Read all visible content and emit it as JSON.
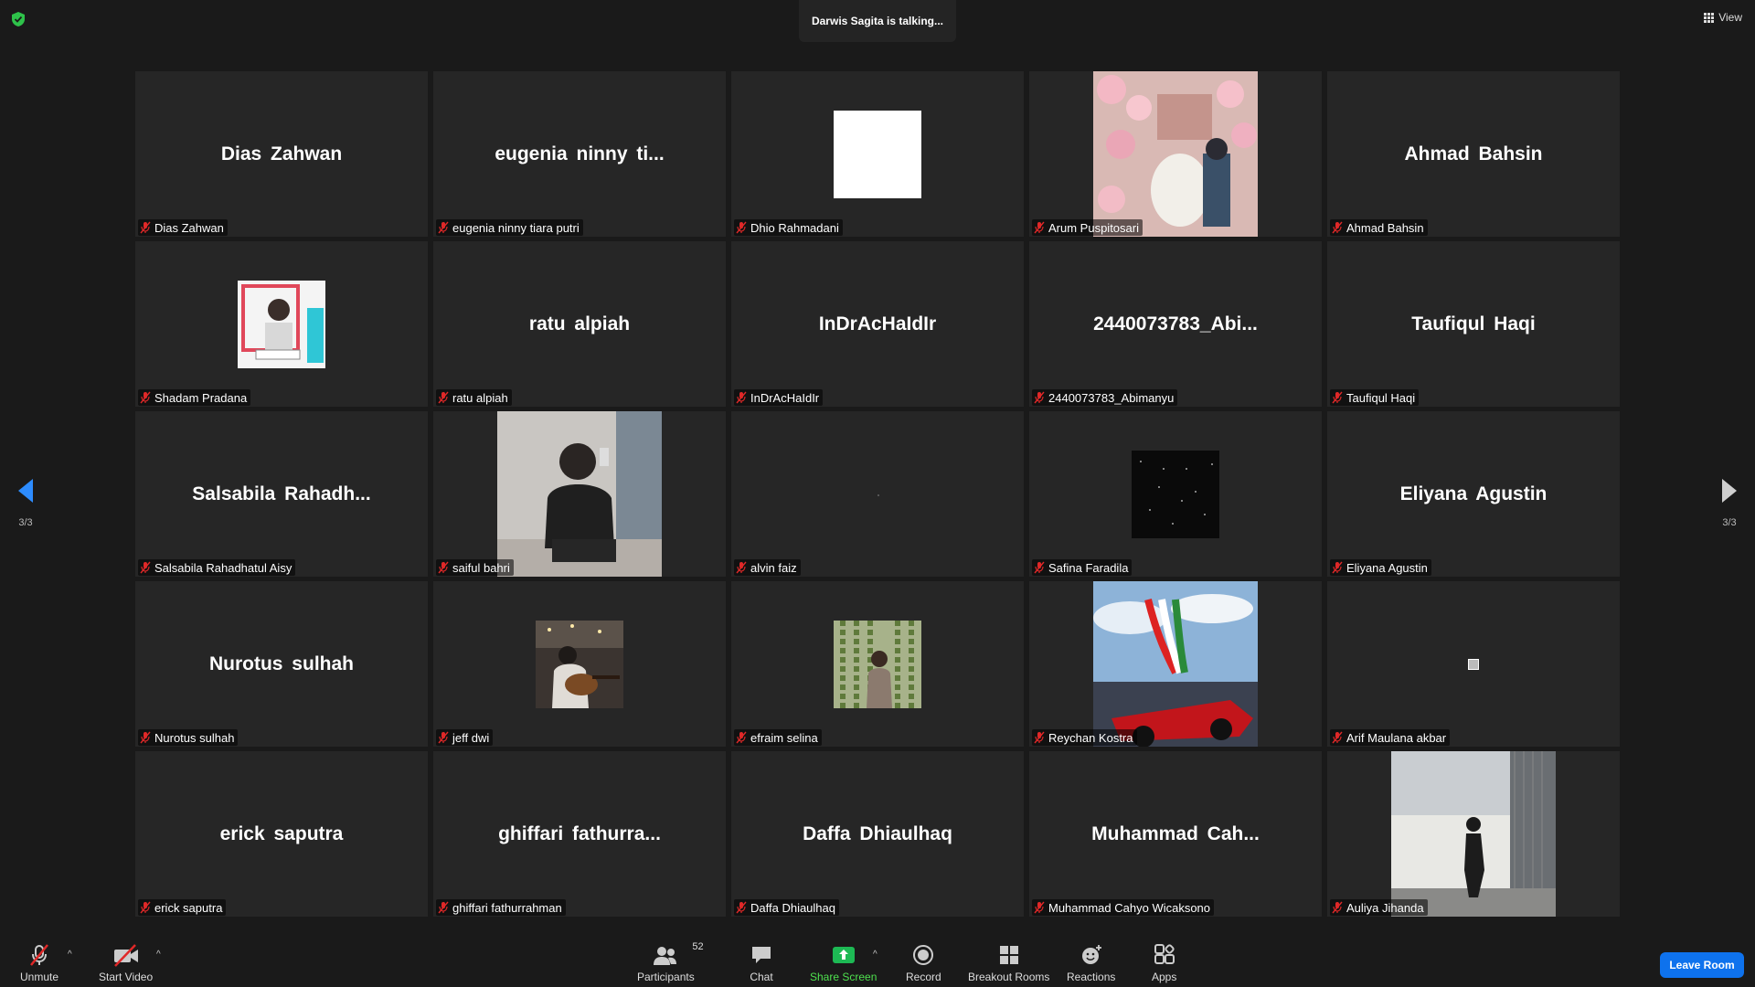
{
  "top": {
    "talking": "Darwis Sagita is talking...",
    "view_label": "View"
  },
  "pagination": {
    "left": "3/3",
    "right": "3/3"
  },
  "tiles": [
    {
      "big": "Dias Zahwan",
      "label": "Dias Zahwan",
      "type": "name"
    },
    {
      "big": "eugenia  ninny  ti...",
      "label": "eugenia ninny tiara putri",
      "type": "name"
    },
    {
      "big": "",
      "label": "Dhio Rahmadani",
      "type": "white-square"
    },
    {
      "big": "",
      "label": "Arum Puspitosari",
      "type": "photo-flowers"
    },
    {
      "big": "Ahmad Bahsin",
      "label": "Ahmad Bahsin",
      "type": "name"
    },
    {
      "big": "",
      "label": "Shadam Pradana",
      "type": "photo-avatar-frame"
    },
    {
      "big": "ratu alpiah",
      "label": "ratu alpiah",
      "type": "name"
    },
    {
      "big": "InDrAcHaIdIr",
      "label": "InDrAcHaIdIr",
      "type": "name"
    },
    {
      "big": "2440073783_Abi...",
      "label": "2440073783_Abimanyu",
      "type": "name"
    },
    {
      "big": "Taufiqul Haqi",
      "label": "Taufiqul Haqi",
      "type": "name"
    },
    {
      "big": "Salsabila  Rahadh...",
      "label": "Salsabila Rahadhatul Aisy",
      "type": "name"
    },
    {
      "big": "",
      "label": "saiful bahri",
      "type": "photo-mirror"
    },
    {
      "big": "",
      "label": "alvin faiz",
      "type": "blank"
    },
    {
      "big": "",
      "label": "Safina Faradila",
      "type": "photo-stars"
    },
    {
      "big": "Eliyana Agustin",
      "label": "Eliyana Agustin",
      "type": "name"
    },
    {
      "big": "Nurotus sulhah",
      "label": "Nurotus sulhah",
      "type": "name"
    },
    {
      "big": "",
      "label": "jeff dwi",
      "type": "photo-guitar"
    },
    {
      "big": "",
      "label": "efraim selina",
      "type": "photo-vines"
    },
    {
      "big": "",
      "label": "Reychan Kostra",
      "type": "photo-racing"
    },
    {
      "big": "",
      "label": "Arif Maulana akbar",
      "type": "tiny-square"
    },
    {
      "big": "erick saputra",
      "label": "erick saputra",
      "type": "name"
    },
    {
      "big": "ghiffari  fathurra...",
      "label": "ghiffari fathurrahman",
      "type": "name"
    },
    {
      "big": "Daffa Dhiaulhaq",
      "label": "Daffa Dhiaulhaq",
      "type": "name"
    },
    {
      "big": "Muhammad  Cah...",
      "label": "Muhammad Cahyo Wicaksono",
      "type": "name"
    },
    {
      "big": "",
      "label": "Auliya Jihanda",
      "type": "photo-building"
    }
  ],
  "toolbar": {
    "unmute": "Unmute",
    "start_video": "Start Video",
    "participants": "Participants",
    "participants_count": "52",
    "chat": "Chat",
    "share_screen": "Share Screen",
    "record": "Record",
    "breakout_rooms": "Breakout Rooms",
    "reactions": "Reactions",
    "apps": "Apps",
    "leave_room": "Leave Room"
  },
  "colors": {
    "background": "#1a1a1a",
    "tile": "#262626",
    "accent_green": "#4ee04e",
    "leave_blue": "#0e72ed",
    "muted_red": "#e02828"
  }
}
